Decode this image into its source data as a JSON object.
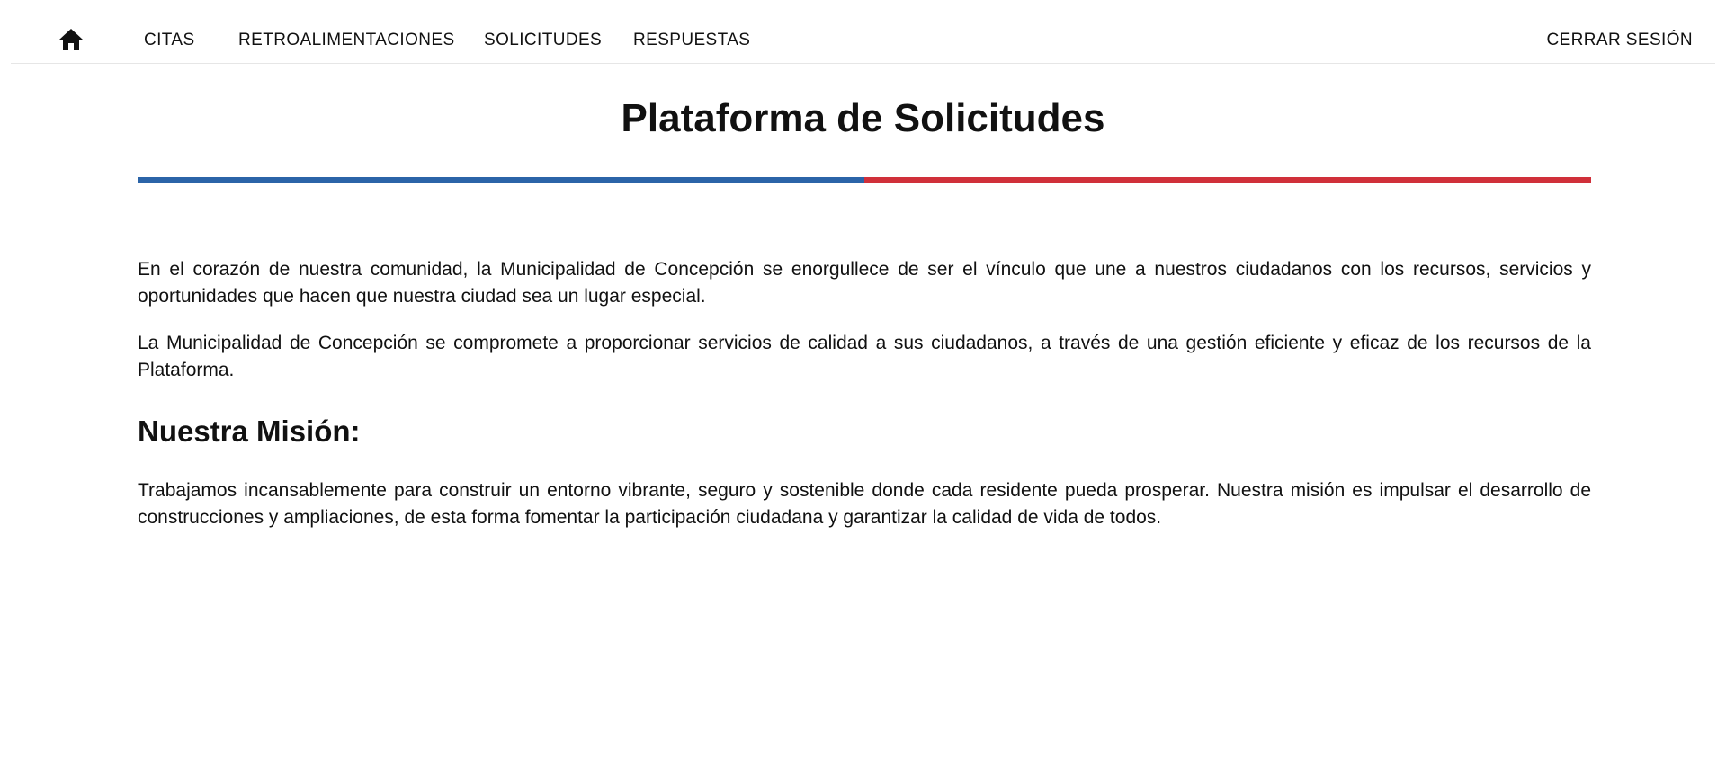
{
  "nav": {
    "home_icon": "home-icon",
    "items": [
      {
        "label": "CITAS"
      },
      {
        "label": "RETROALIMENTACIONES"
      },
      {
        "label": "SOLICITUDES"
      },
      {
        "label": "RESPUESTAS"
      }
    ],
    "logout_label": "CERRAR SESIÓN"
  },
  "main": {
    "title": "Plataforma de Solicitudes",
    "divider_colors": [
      "#2b64a8",
      "#d0303a"
    ],
    "paragraphs": [
      "En el corazón de nuestra comunidad, la Municipalidad de Concepción se enorgullece de ser el vínculo que une a nuestros ciudadanos con los recursos, servicios y oportunidades que hacen que nuestra ciudad sea un lugar especial.",
      "La Municipalidad de Concepción se compromete a proporcionar servicios de calidad a sus ciudadanos, a través de una gestión eficiente y eficaz de los recursos de la Plataforma."
    ],
    "mission_heading": "Nuestra Misión:",
    "mission_text": "Trabajamos incansablemente para construir un entorno vibrante, seguro y sostenible donde cada residente pueda prosperar. Nuestra misión es impulsar el desarrollo de construcciones y ampliaciones, de esta forma fomentar la participación ciudadana y garantizar la calidad de vida de todos."
  }
}
